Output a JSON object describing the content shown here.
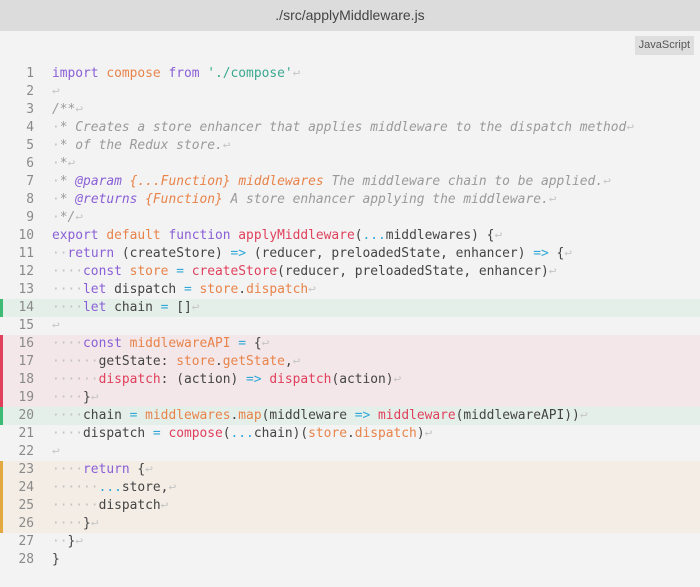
{
  "window": {
    "title": "./src/applyMiddleware.js"
  },
  "language_badge": "JavaScript",
  "colors": {
    "added": "#3dba74",
    "removed": "#e0405c",
    "modified": "#e3a840"
  },
  "lines": [
    {
      "n": "1",
      "hl": "",
      "tokens": [
        [
          "kw",
          "import"
        ],
        [
          "plain",
          " "
        ],
        [
          "var",
          "compose"
        ],
        [
          "plain",
          " "
        ],
        [
          "kw",
          "from"
        ],
        [
          "plain",
          " "
        ],
        [
          "str",
          "'./compose'"
        ],
        [
          "nl",
          "↩"
        ]
      ]
    },
    {
      "n": "2",
      "hl": "",
      "tokens": [
        [
          "nl",
          "↩"
        ]
      ]
    },
    {
      "n": "3",
      "hl": "",
      "tokens": [
        [
          "com",
          "/**"
        ],
        [
          "nl",
          "↩"
        ]
      ]
    },
    {
      "n": "4",
      "hl": "",
      "tokens": [
        [
          "ws",
          "·"
        ],
        [
          "com",
          "* Creates a store enhancer that applies middleware to the dispatch method"
        ],
        [
          "nl",
          "↩"
        ]
      ]
    },
    {
      "n": "5",
      "hl": "",
      "tokens": [
        [
          "ws",
          "·"
        ],
        [
          "com",
          "* of the Redux store."
        ],
        [
          "nl",
          "↩"
        ]
      ]
    },
    {
      "n": "6",
      "hl": "",
      "tokens": [
        [
          "ws",
          "·"
        ],
        [
          "com",
          "*"
        ],
        [
          "nl",
          "↩"
        ]
      ]
    },
    {
      "n": "7",
      "hl": "",
      "tokens": [
        [
          "ws",
          "·"
        ],
        [
          "com",
          "* "
        ],
        [
          "tag",
          "@param"
        ],
        [
          "com",
          " "
        ],
        [
          "type",
          "{...Function}"
        ],
        [
          "com",
          " "
        ],
        [
          "type",
          "middlewares"
        ],
        [
          "com",
          " The middleware chain to be applied."
        ],
        [
          "nl",
          "↩"
        ]
      ]
    },
    {
      "n": "8",
      "hl": "",
      "tokens": [
        [
          "ws",
          "·"
        ],
        [
          "com",
          "* "
        ],
        [
          "tag",
          "@returns"
        ],
        [
          "com",
          " "
        ],
        [
          "type",
          "{Function}"
        ],
        [
          "com",
          " A store enhancer applying the middleware."
        ],
        [
          "nl",
          "↩"
        ]
      ]
    },
    {
      "n": "9",
      "hl": "",
      "tokens": [
        [
          "ws",
          "·"
        ],
        [
          "com",
          "*/"
        ],
        [
          "nl",
          "↩"
        ]
      ]
    },
    {
      "n": "10",
      "hl": "",
      "tokens": [
        [
          "kw",
          "export"
        ],
        [
          "plain",
          " "
        ],
        [
          "kw2",
          "default"
        ],
        [
          "plain",
          " "
        ],
        [
          "kw",
          "function"
        ],
        [
          "plain",
          " "
        ],
        [
          "fn",
          "applyMiddleware"
        ],
        [
          "plain",
          "("
        ],
        [
          "op",
          "..."
        ],
        [
          "plain",
          "middlewares) {"
        ],
        [
          "nl",
          "↩"
        ]
      ]
    },
    {
      "n": "11",
      "hl": "",
      "tokens": [
        [
          "ws",
          "··"
        ],
        [
          "kw",
          "return"
        ],
        [
          "plain",
          " (createStore) "
        ],
        [
          "op",
          "=>"
        ],
        [
          "plain",
          " (reducer, preloadedState, enhancer) "
        ],
        [
          "op",
          "=>"
        ],
        [
          "plain",
          " {"
        ],
        [
          "nl",
          "↩"
        ]
      ]
    },
    {
      "n": "12",
      "hl": "",
      "tokens": [
        [
          "ws",
          "····"
        ],
        [
          "kw",
          "const"
        ],
        [
          "plain",
          " "
        ],
        [
          "var",
          "store"
        ],
        [
          "plain",
          " "
        ],
        [
          "op",
          "="
        ],
        [
          "plain",
          " "
        ],
        [
          "fn",
          "createStore"
        ],
        [
          "plain",
          "(reducer, preloadedState, enhancer)"
        ],
        [
          "nl",
          "↩"
        ]
      ]
    },
    {
      "n": "13",
      "hl": "",
      "tokens": [
        [
          "ws",
          "····"
        ],
        [
          "kw",
          "let"
        ],
        [
          "plain",
          " dispatch "
        ],
        [
          "op",
          "="
        ],
        [
          "plain",
          " "
        ],
        [
          "var",
          "store"
        ],
        [
          "plain",
          "."
        ],
        [
          "var",
          "dispatch"
        ],
        [
          "nl",
          "↩"
        ]
      ]
    },
    {
      "n": "14",
      "hl": "green",
      "tokens": [
        [
          "ws",
          "····"
        ],
        [
          "kw",
          "let"
        ],
        [
          "plain",
          " chain "
        ],
        [
          "op",
          "="
        ],
        [
          "plain",
          " []"
        ],
        [
          "nl",
          "↩"
        ]
      ]
    },
    {
      "n": "15",
      "hl": "",
      "tokens": [
        [
          "nl",
          "↩"
        ]
      ]
    },
    {
      "n": "16",
      "hl": "red",
      "tokens": [
        [
          "ws",
          "····"
        ],
        [
          "kw",
          "const"
        ],
        [
          "plain",
          " "
        ],
        [
          "var",
          "middlewareAPI"
        ],
        [
          "plain",
          " "
        ],
        [
          "op",
          "="
        ],
        [
          "plain",
          " {"
        ],
        [
          "nl",
          "↩"
        ]
      ]
    },
    {
      "n": "17",
      "hl": "red",
      "tokens": [
        [
          "ws",
          "······"
        ],
        [
          "plain",
          "getState: "
        ],
        [
          "var",
          "store"
        ],
        [
          "plain",
          "."
        ],
        [
          "var",
          "getState"
        ],
        [
          "plain",
          ","
        ],
        [
          "nl",
          "↩"
        ]
      ]
    },
    {
      "n": "18",
      "hl": "red",
      "tokens": [
        [
          "ws",
          "······"
        ],
        [
          "fn",
          "dispatch"
        ],
        [
          "plain",
          ": (action) "
        ],
        [
          "op",
          "=>"
        ],
        [
          "plain",
          " "
        ],
        [
          "fn",
          "dispatch"
        ],
        [
          "plain",
          "(action)"
        ],
        [
          "nl",
          "↩"
        ]
      ]
    },
    {
      "n": "19",
      "hl": "red",
      "tokens": [
        [
          "ws",
          "····"
        ],
        [
          "plain",
          "}"
        ],
        [
          "nl",
          "↩"
        ]
      ]
    },
    {
      "n": "20",
      "hl": "green",
      "tokens": [
        [
          "ws",
          "····"
        ],
        [
          "plain",
          "chain "
        ],
        [
          "op",
          "="
        ],
        [
          "plain",
          " "
        ],
        [
          "var",
          "middlewares"
        ],
        [
          "plain",
          "."
        ],
        [
          "var",
          "map"
        ],
        [
          "plain",
          "(middleware "
        ],
        [
          "op",
          "=>"
        ],
        [
          "plain",
          " "
        ],
        [
          "fn",
          "middleware"
        ],
        [
          "plain",
          "(middlewareAPI))"
        ],
        [
          "nl",
          "↩"
        ]
      ]
    },
    {
      "n": "21",
      "hl": "",
      "tokens": [
        [
          "ws",
          "····"
        ],
        [
          "plain",
          "dispatch "
        ],
        [
          "op",
          "="
        ],
        [
          "plain",
          " "
        ],
        [
          "fn",
          "compose"
        ],
        [
          "plain",
          "("
        ],
        [
          "op",
          "..."
        ],
        [
          "plain",
          "chain)("
        ],
        [
          "var",
          "store"
        ],
        [
          "plain",
          "."
        ],
        [
          "var",
          "dispatch"
        ],
        [
          "plain",
          ")"
        ],
        [
          "nl",
          "↩"
        ]
      ]
    },
    {
      "n": "22",
      "hl": "",
      "tokens": [
        [
          "nl",
          "↩"
        ]
      ]
    },
    {
      "n": "23",
      "hl": "orange",
      "tokens": [
        [
          "ws",
          "····"
        ],
        [
          "kw",
          "return"
        ],
        [
          "plain",
          " {"
        ],
        [
          "nl",
          "↩"
        ]
      ]
    },
    {
      "n": "24",
      "hl": "orange",
      "tokens": [
        [
          "ws",
          "······"
        ],
        [
          "op",
          "..."
        ],
        [
          "plain",
          "store,"
        ],
        [
          "nl",
          "↩"
        ]
      ]
    },
    {
      "n": "25",
      "hl": "orange",
      "tokens": [
        [
          "ws",
          "······"
        ],
        [
          "plain",
          "dispatch"
        ],
        [
          "nl",
          "↩"
        ]
      ]
    },
    {
      "n": "26",
      "hl": "orange",
      "tokens": [
        [
          "ws",
          "····"
        ],
        [
          "plain",
          "}"
        ],
        [
          "nl",
          "↩"
        ]
      ]
    },
    {
      "n": "27",
      "hl": "",
      "tokens": [
        [
          "ws",
          "··"
        ],
        [
          "plain",
          "}"
        ],
        [
          "nl",
          "↩"
        ]
      ]
    },
    {
      "n": "28",
      "hl": "",
      "tokens": [
        [
          "plain",
          "}"
        ]
      ]
    }
  ]
}
